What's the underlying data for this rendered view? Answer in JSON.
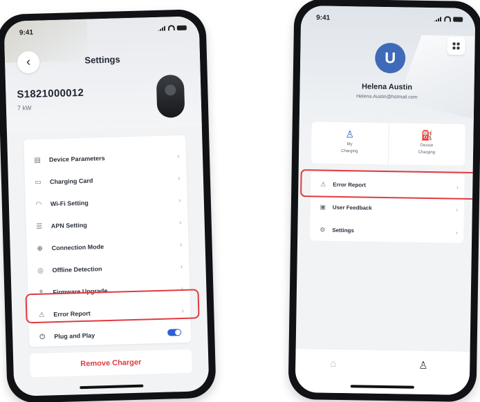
{
  "settings_screen": {
    "status": {
      "time": "9:41"
    },
    "back_glyph": "‹",
    "title": "Settings",
    "device": {
      "serial": "S1821000012",
      "power": "7 kW"
    },
    "menu": [
      {
        "icon": "device-parameters-icon",
        "glyph": "▤",
        "label": "Device Parameters",
        "chevron": "›"
      },
      {
        "icon": "charging-card-icon",
        "glyph": "▭",
        "label": "Charging Card",
        "chevron": "›"
      },
      {
        "icon": "wifi-icon",
        "glyph": "◠",
        "label": "Wi-Fi Setting",
        "chevron": "›"
      },
      {
        "icon": "apn-icon",
        "glyph": "☰",
        "label": "APN Setting",
        "chevron": "›"
      },
      {
        "icon": "connection-mode-icon",
        "glyph": "⊕",
        "label": "Connection Mode",
        "chevron": "›"
      },
      {
        "icon": "offline-detection-icon",
        "glyph": "◎",
        "label": "Offline Detection",
        "chevron": "›"
      },
      {
        "icon": "firmware-upgrade-icon",
        "glyph": "⇪",
        "label": "Firmware Upgrade",
        "chevron": "›"
      },
      {
        "icon": "warning-icon",
        "glyph": "⚠",
        "label": "Error Report",
        "chevron": "›"
      },
      {
        "icon": "plug-icon",
        "glyph": "⏻",
        "label": "Plug and Play",
        "toggle": "on"
      }
    ],
    "remove_button": "Remove Charger",
    "highlight_color": "#e0393f"
  },
  "profile_screen": {
    "status": {
      "time": "9:41"
    },
    "avatar_glyph": "U",
    "user": {
      "name": "Helena Austin",
      "email": "Helena.Austin@hotmail.com"
    },
    "quick_actions": [
      {
        "icon": "user-charging-icon",
        "glyph": "♙",
        "line1": "My",
        "line2": "Charging"
      },
      {
        "icon": "device-charging-icon",
        "glyph": "⛽",
        "line1": "Device",
        "line2": "Charging"
      }
    ],
    "menu": [
      {
        "icon": "warning-icon",
        "glyph": "⚠",
        "label": "Error Report",
        "chevron": "›"
      },
      {
        "icon": "feedback-icon",
        "glyph": "▣",
        "label": "User Feedback",
        "chevron": "›"
      },
      {
        "icon": "settings-icon",
        "glyph": "⚙",
        "label": "Settings",
        "chevron": "›"
      }
    ],
    "tabs": [
      {
        "icon": "home-icon",
        "glyph": "⌂"
      },
      {
        "icon": "profile-icon",
        "glyph": "♙"
      }
    ],
    "accent_color": "#3e6bb8"
  }
}
